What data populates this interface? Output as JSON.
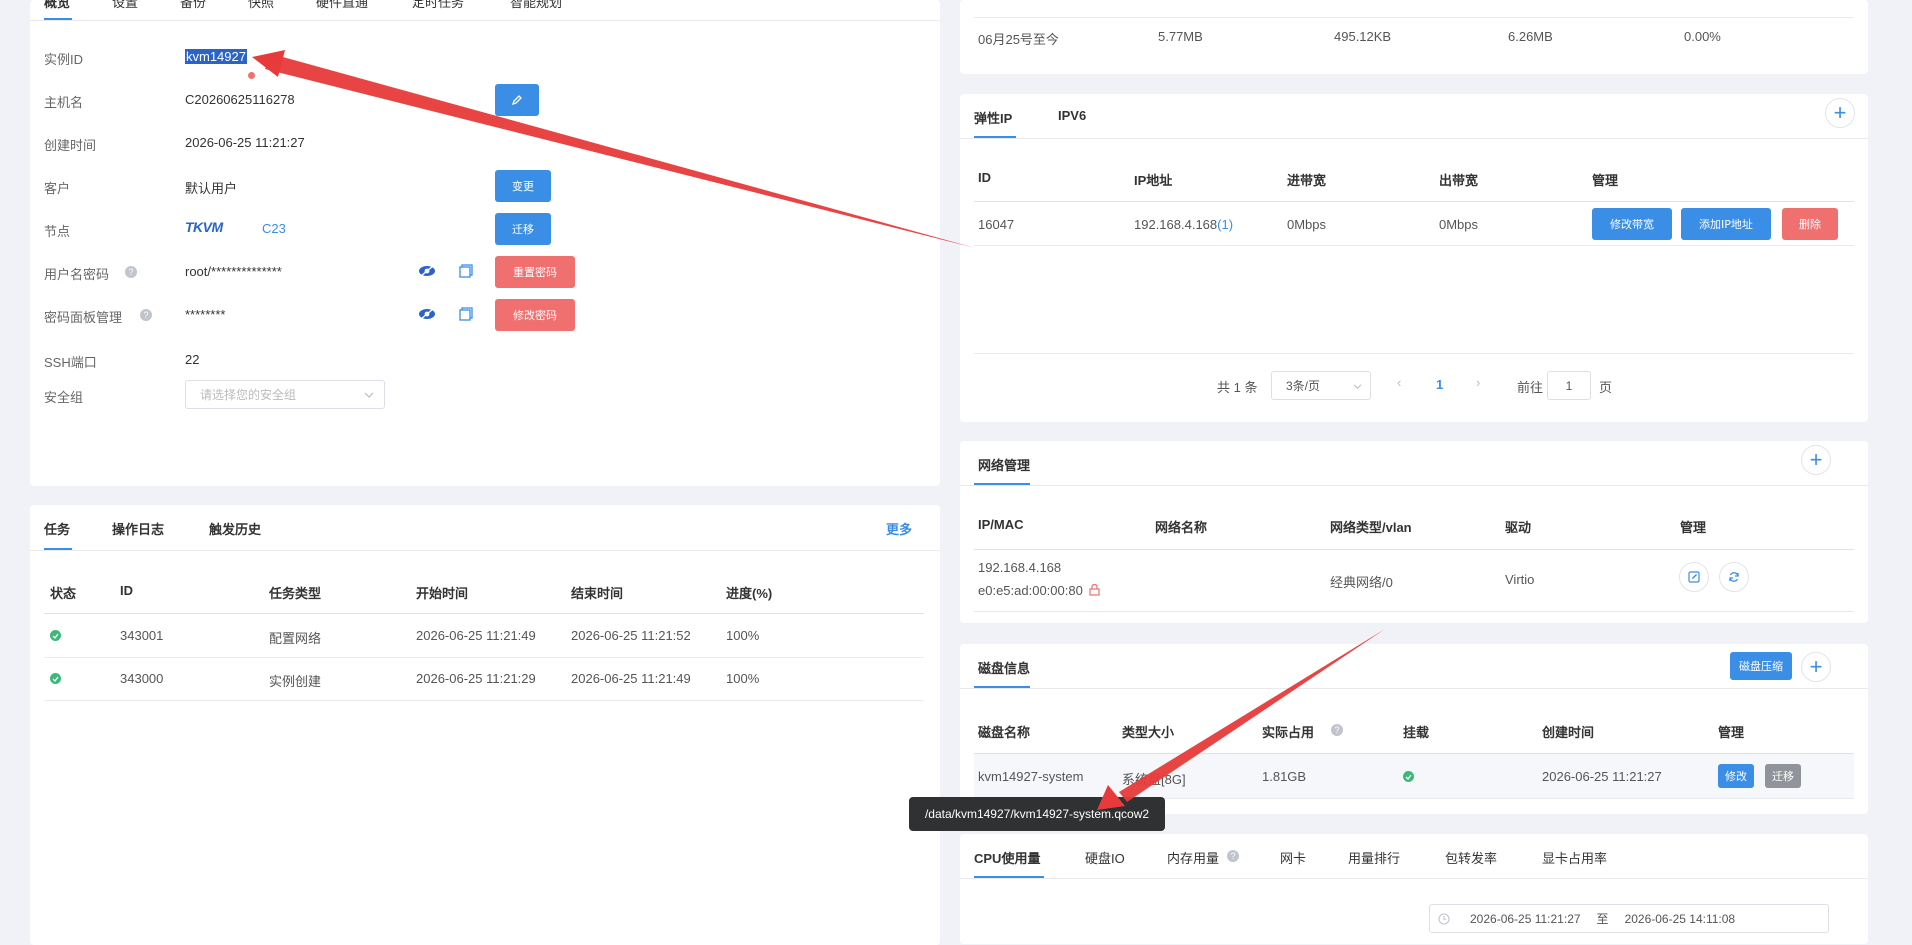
{
  "top_tabs": [
    "概览",
    "设置",
    "备份",
    "快照",
    "硬件直通",
    "定时任务",
    "智能规划"
  ],
  "instance": {
    "rows": [
      {
        "label": "实例ID",
        "value": "kvm14927"
      },
      {
        "label": "主机名",
        "value": "C20260625116278"
      },
      {
        "label": "创建时间",
        "value": "2026-06-25 11:21:27"
      },
      {
        "label": "客户",
        "value": "默认用户"
      },
      {
        "label": "节点",
        "value": "C23"
      },
      {
        "label": "用户名密码",
        "value": "root/**************"
      },
      {
        "label": "密码面板管理",
        "value": "********"
      },
      {
        "label": "SSH端口",
        "value": "22"
      },
      {
        "label": "安全组",
        "value": ""
      }
    ],
    "node_logo": "TKVM",
    "security_group_placeholder": "请选择您的安全组",
    "buttons": {
      "change": "变更",
      "migrate": "迁移",
      "reset_password": "重置密码",
      "modify_password": "修改密码"
    }
  },
  "tasks": {
    "tabs": [
      "任务",
      "操作日志",
      "触发历史"
    ],
    "more": "更多",
    "headers": [
      "状态",
      "ID",
      "任务类型",
      "开始时间",
      "结束时间",
      "进度(%)"
    ],
    "rows": [
      {
        "id": "343001",
        "type": "配置网络",
        "start": "2026-06-25 11:21:49",
        "end": "2026-06-25 11:21:52",
        "progress": "100%"
      },
      {
        "id": "343000",
        "type": "实例创建",
        "start": "2026-06-25 11:21:29",
        "end": "2026-06-25 11:21:49",
        "progress": "100%"
      }
    ]
  },
  "traffic": {
    "row": [
      "06月25号至今",
      "5.77MB",
      "495.12KB",
      "6.26MB",
      "0.00%"
    ]
  },
  "elastic_ip": {
    "tabs": [
      "弹性IP",
      "IPV6"
    ],
    "headers": [
      "ID",
      "IP地址",
      "进带宽",
      "出带宽",
      "管理"
    ],
    "row": {
      "id": "16047",
      "ip": "192.168.4.168",
      "ip_count": "(1)",
      "in_bw": "0Mbps",
      "out_bw": "0Mbps"
    },
    "buttons": {
      "modify_bw": "修改带宽",
      "add_ip": "添加IP地址",
      "delete": "删除"
    },
    "pagination": {
      "total": "共 1 条",
      "page_size": "3条/页",
      "page": "1",
      "goto": "前往",
      "goto_value": "1",
      "page_unit": "页"
    }
  },
  "network": {
    "title": "网络管理",
    "headers": [
      "IP/MAC",
      "网络名称",
      "网络类型/vlan",
      "驱动",
      "管理"
    ],
    "row": {
      "ip": "192.168.4.168",
      "mac": "e0:e5:ad:00:00:80",
      "name": "",
      "type": "经典网络/0",
      "driver": "Virtio"
    }
  },
  "disk": {
    "title": "磁盘信息",
    "compress": "磁盘压缩",
    "headers": [
      "磁盘名称",
      "类型大小",
      "实际占用",
      "挂载",
      "创建时间",
      "管理"
    ],
    "row": {
      "name": "kvm14927-system",
      "type": "系统盘[8G]",
      "used": "1.81GB",
      "created": "2026-06-25 11:21:27"
    },
    "buttons": {
      "modify": "修改",
      "migrate": "迁移"
    },
    "tooltip": "/data/kvm14927/kvm14927-system.qcow2"
  },
  "monitor": {
    "tabs": [
      "CPU使用量",
      "硬盘IO",
      "内存用量",
      "网卡",
      "用量排行",
      "包转发率",
      "显卡占用率"
    ],
    "range_start": "2026-06-25 11:21:27",
    "range_sep": "至",
    "range_end": "2026-06-25 14:11:08"
  },
  "colors": {
    "accent": "#3a8ee6",
    "danger": "#f07070",
    "arrow": "#e83a3a",
    "success": "#3cb878"
  }
}
